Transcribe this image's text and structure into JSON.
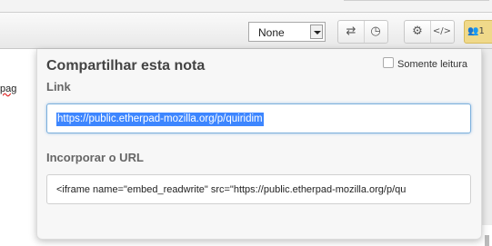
{
  "toolbar": {
    "select_value": "None",
    "icons": [
      "swap-icon",
      "clock-icon",
      "gear-icon",
      "code-icon"
    ],
    "users_count": "1"
  },
  "editor": {
    "partial_text": "pag"
  },
  "share": {
    "title": "Compartilhar esta nota",
    "readonly_label": "Somente leitura",
    "link_label": "Link",
    "link_value": "https://public.etherpad-mozilla.org/p/quiridim",
    "embed_label": "Incorporar o URL",
    "embed_value": "<iframe name=\"embed_readwrite\" src=\"https://public.etherpad-mozilla.org/p/qu"
  },
  "colors": {
    "selection": "#3d86ff",
    "users_button": "#f0d98a",
    "focus_border": "#7cb0dc"
  }
}
